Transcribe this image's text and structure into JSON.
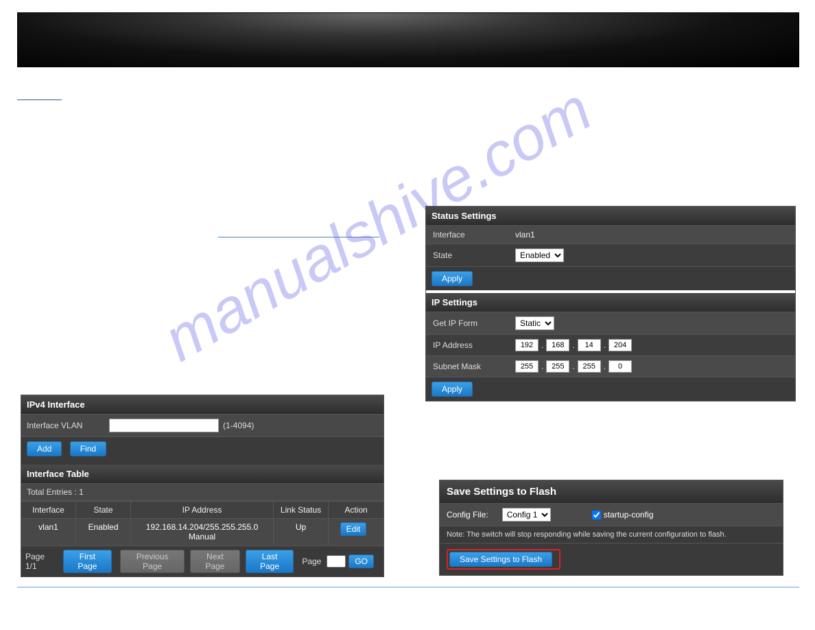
{
  "watermark": "manualshive.com",
  "left": {
    "title": "IPv4 Interface",
    "vlan_label": "Interface VLAN",
    "vlan_value": "",
    "vlan_range": "(1-4094)",
    "add_btn": "Add",
    "find_btn": "Find",
    "table_title": "Interface Table",
    "total_entries": "Total Entries : 1",
    "headers": {
      "if": "Interface",
      "state": "State",
      "ip": "IP Address",
      "link": "Link Status",
      "act": "Action"
    },
    "row": {
      "if": "vlan1",
      "state": "Enabled",
      "ip": "192.168.14.204/255.255.255.0 Manual",
      "link": "Up",
      "edit": "Edit"
    },
    "pager": {
      "page": "Page 1/1",
      "first": "First Page",
      "prev": "Previous Page",
      "next": "Next Page",
      "last": "Last Page",
      "page_lbl": "Page",
      "page_val": "",
      "go": "GO"
    }
  },
  "status": {
    "title": "Status Settings",
    "if_lbl": "Interface",
    "if_val": "vlan1",
    "state_lbl": "State",
    "state_val": "Enabled",
    "apply": "Apply"
  },
  "ip": {
    "title": "IP Settings",
    "form_lbl": "Get IP Form",
    "form_val": "Static",
    "addr_lbl": "IP Address",
    "addr": [
      "192",
      "168",
      "14",
      "204"
    ],
    "mask_lbl": "Subnet Mask",
    "mask": [
      "255",
      "255",
      "255",
      "0"
    ],
    "apply": "Apply"
  },
  "save": {
    "title": "Save Settings to Flash",
    "config_lbl": "Config File:",
    "config_val": "Config 1",
    "startup_chk": true,
    "startup_lbl": "startup-config",
    "note": "Note: The switch will stop responding while saving the current configuration to flash.",
    "btn": "Save Settings to Flash"
  }
}
